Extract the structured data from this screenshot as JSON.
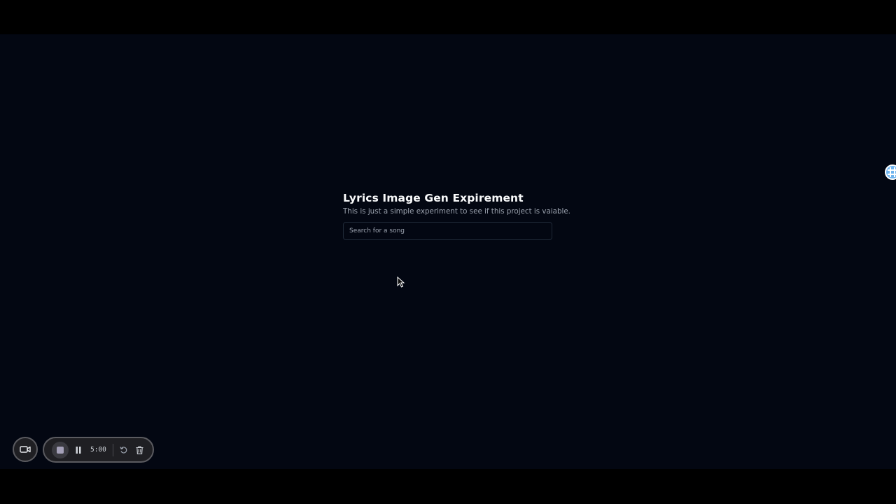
{
  "app": {
    "title": "Lyrics Image Gen Expirement",
    "subtitle": "This is just a simple experiment to see if this project is vaiable."
  },
  "search": {
    "placeholder": "Search for a song",
    "value": ""
  },
  "recorder": {
    "timer": "5:00",
    "icons": {
      "camera": "video-camera-icon",
      "stop": "stop-icon",
      "pause": "pause-icon",
      "restart": "restart-icon",
      "delete": "trash-icon"
    }
  },
  "extension": {
    "icon": "grid-extension-icon"
  },
  "colors": {
    "background": "#030712",
    "title": "#f9fafb",
    "subtitle": "#9ca3af",
    "input_border": "#1f2937",
    "toolbar_bg": "#1f1f23",
    "toolbar_border": "#5b5b60",
    "extension_accent": "#6fb4ee"
  }
}
